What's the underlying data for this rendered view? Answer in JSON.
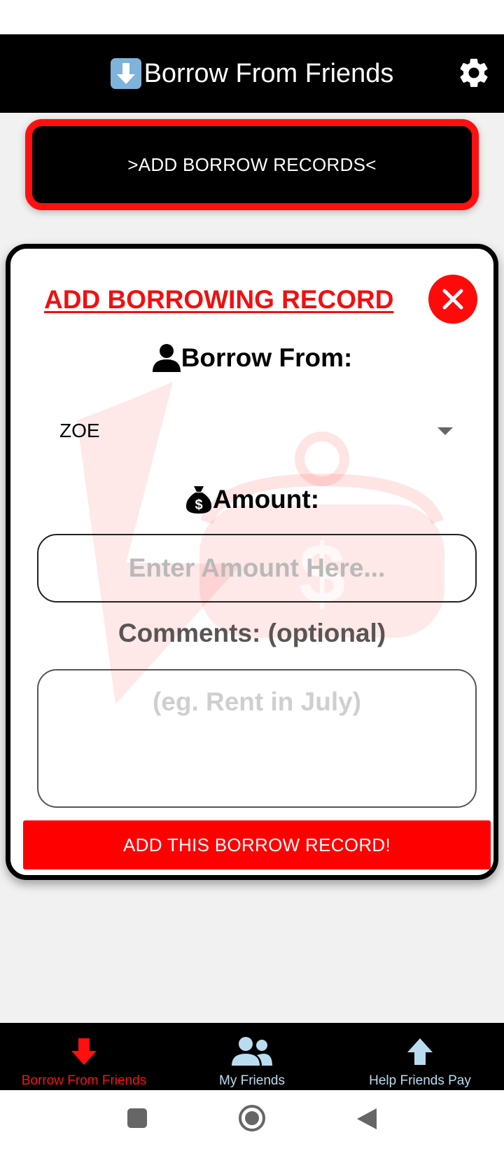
{
  "header": {
    "title": "Borrow From Friends"
  },
  "add_records": {
    "label": ">ADD BORROW RECORDS<"
  },
  "modal": {
    "title": "ADD BORROWING RECORD",
    "borrow_from_label": "Borrow From:",
    "friend_selected": "ZOE",
    "amount_label": "Amount:",
    "amount_placeholder": "Enter Amount Here...",
    "amount_value": "",
    "comments_label": "Comments: (optional)",
    "comments_placeholder": "(eg. Rent in July)",
    "comments_value": "",
    "submit_label": "ADD THIS BORROW RECORD!"
  },
  "bottom_nav": {
    "items": [
      {
        "label": "Borrow From Friends",
        "icon": "arrow-down-icon",
        "active": true
      },
      {
        "label": "My Friends",
        "icon": "users-icon",
        "active": false
      },
      {
        "label": "Help Friends Pay",
        "icon": "arrow-up-icon",
        "active": false
      }
    ]
  },
  "colors": {
    "accent": "#ff0a0a",
    "header_bg": "#000000",
    "nav_inactive": "#b9dcf0"
  }
}
